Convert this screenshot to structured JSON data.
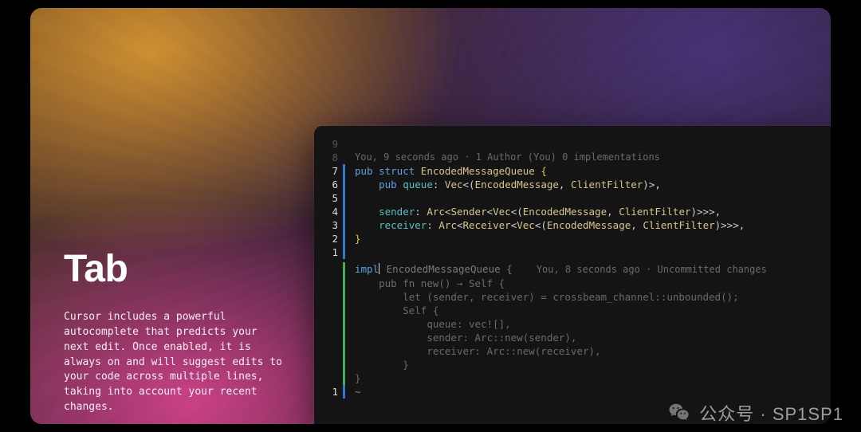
{
  "feature": {
    "title": "Tab",
    "description": "Cursor includes a powerful autocomplete that predicts your next edit. Once enabled, it is always on and will suggest edits to your code across multiple lines, taking into account your recent changes."
  },
  "editor": {
    "codelens_top": "You, 9 seconds ago · 1 Author (You) 0 implementations",
    "codelens_impl": "You, 8 seconds ago · Uncommitted changes",
    "gutter": {
      "top_blank": "9",
      "codelens": "8",
      "l1": "7",
      "l2": "6",
      "l3": "5",
      "l4": "4",
      "l5": "3",
      "l6": "2",
      "l7": "1",
      "bottom": "1"
    },
    "tokens": {
      "pub": "pub",
      "struct": "struct",
      "impl": "impl",
      "fn": "fn",
      "let": "let",
      "self_type": "Self",
      "new": "new",
      "arrow": "→",
      "EncodedMessageQueue": "EncodedMessageQueue",
      "queue": "queue",
      "sender": "sender",
      "receiver": "receiver",
      "Vec": "Vec",
      "Arc": "Arc",
      "Sender": "Sender",
      "Receiver": "Receiver",
      "EncodedMessage": "EncodedMessage",
      "ClientFilter": "ClientFilter",
      "vec_macro": "vec!",
      "Arc_new": "Arc::new",
      "crossbeam": "crossbeam_channel::unbounded",
      "tilde": "~"
    },
    "suggestion_lines": {
      "s1": "pub fn new() → Self {",
      "s2": "    let (sender, receiver) = crossbeam_channel::unbounded();",
      "s3": "    Self {",
      "s4": "        queue: vec![],",
      "s5": "        sender: Arc::new(sender),",
      "s6": "        receiver: Arc::new(receiver),",
      "s7": "    }",
      "s8": "}"
    }
  },
  "watermark": {
    "label": "公众号 · SP1SP1"
  }
}
